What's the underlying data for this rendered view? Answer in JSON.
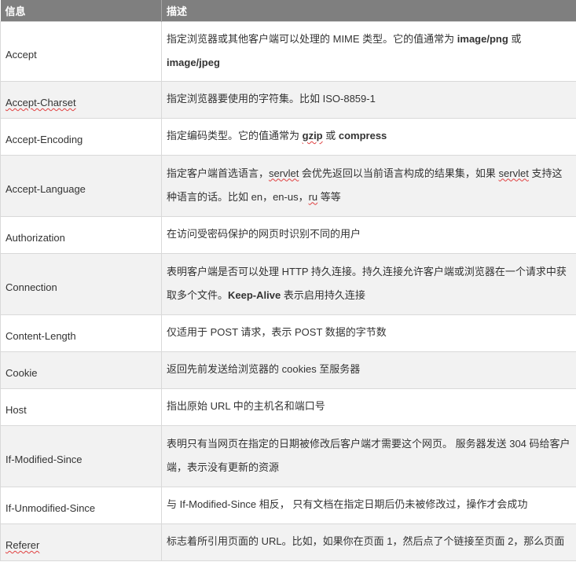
{
  "header": {
    "col1": "信息",
    "col2": "描述"
  },
  "rows": [
    {
      "name": [
        {
          "t": "Accept"
        }
      ],
      "desc": [
        {
          "t": "指定浏览器或其他客户端可以处理的 MIME 类型。它的值通常为 "
        },
        {
          "t": "image/png",
          "b": true
        },
        {
          "t": " 或 "
        },
        {
          "t": "image/jpeg",
          "b": true
        }
      ]
    },
    {
      "name": [
        {
          "t": "Accept-Charset",
          "w": true
        }
      ],
      "desc": [
        {
          "t": "指定浏览器要使用的字符集。比如 ISO-8859-1"
        }
      ]
    },
    {
      "name": [
        {
          "t": "Accept-Encoding"
        }
      ],
      "desc": [
        {
          "t": "指定编码类型。它的值通常为 "
        },
        {
          "t": "gzip",
          "b": true,
          "w": true
        },
        {
          "t": " 或 "
        },
        {
          "t": "compress",
          "b": true
        }
      ]
    },
    {
      "name": [
        {
          "t": "Accept-Language"
        }
      ],
      "desc": [
        {
          "t": "指定客户端首选语言，"
        },
        {
          "t": "servlet",
          "w": true
        },
        {
          "t": " 会优先返回以当前语言构成的结果集，如果 "
        },
        {
          "t": "servlet",
          "w": true
        },
        {
          "t": " 支持这种语言的话。比如 en，en-us，"
        },
        {
          "t": "ru",
          "w": true
        },
        {
          "t": " 等等"
        }
      ]
    },
    {
      "name": [
        {
          "t": "Authorization"
        }
      ],
      "desc": [
        {
          "t": "在访问受密码保护的网页时识别不同的用户"
        }
      ]
    },
    {
      "name": [
        {
          "t": "Connection"
        }
      ],
      "desc": [
        {
          "t": "表明客户端是否可以处理 HTTP 持久连接。持久连接允许客户端或浏览器在一个请求中获取多个文件。"
        },
        {
          "t": "Keep-Alive",
          "b": true
        },
        {
          "t": " 表示启用持久连接"
        }
      ]
    },
    {
      "name": [
        {
          "t": "Content-Length"
        }
      ],
      "desc": [
        {
          "t": "仅适用于 POST 请求，表示 POST 数据的字节数"
        }
      ]
    },
    {
      "name": [
        {
          "t": "Cookie"
        }
      ],
      "desc": [
        {
          "t": "返回先前发送给浏览器的 cookies 至服务器"
        }
      ]
    },
    {
      "name": [
        {
          "t": "Host"
        }
      ],
      "desc": [
        {
          "t": "指出原始 URL 中的主机名和端口号"
        }
      ]
    },
    {
      "name": [
        {
          "t": "If-Modified-Since"
        }
      ],
      "desc": [
        {
          "t": "表明只有当网页在指定的日期被修改后客户端才需要这个网页。 服务器发送 304 码给客户端，表示没有更新的资源"
        }
      ]
    },
    {
      "name": [
        {
          "t": "If-Unmodified-Since"
        }
      ],
      "desc": [
        {
          "t": "与 If-Modified-Since 相反， 只有文档在指定日期后仍未被修改过，操作才会成功"
        }
      ]
    },
    {
      "name": [
        {
          "t": "Referer",
          "w": true
        }
      ],
      "desc": [
        {
          "t": "标志着所引用页面的 URL。比如，如果你在页面 1，然后点了个链接至页面 2，那么页面"
        }
      ]
    }
  ]
}
